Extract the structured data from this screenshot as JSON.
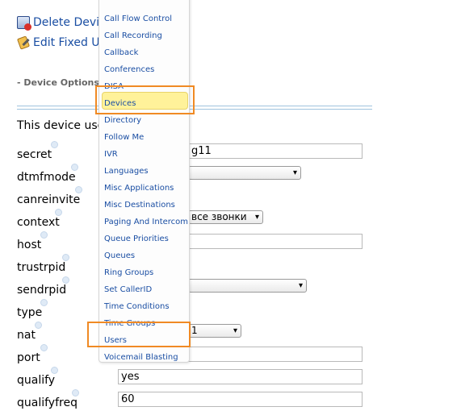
{
  "actions": {
    "delete_label": "Delete Devic",
    "edit_label": "Edit Fixed Us"
  },
  "section": {
    "heading": "- Device Options",
    "intro": "This device uses"
  },
  "fields": [
    {
      "name": "secret",
      "kind": "text",
      "value": "g11"
    },
    {
      "name": "dtmfmode",
      "kind": "select",
      "value": ""
    },
    {
      "name": "canreinvite",
      "kind": "none",
      "value": ""
    },
    {
      "name": "context",
      "kind": "select",
      "value": "все звонки"
    },
    {
      "name": "host",
      "kind": "text",
      "value": ""
    },
    {
      "name": "trustrpid",
      "kind": "none",
      "value": ""
    },
    {
      "name": "sendrpid",
      "kind": "select",
      "value": ""
    },
    {
      "name": "type",
      "kind": "none",
      "value": ""
    },
    {
      "name": "nat",
      "kind": "select",
      "value": "1"
    },
    {
      "name": "port",
      "kind": "text",
      "value": ""
    },
    {
      "name": "qualify",
      "kind": "text",
      "value": "yes"
    },
    {
      "name": "qualifyfreq",
      "kind": "text",
      "value": "60"
    }
  ],
  "menu": {
    "items": [
      "Call Flow Control",
      "Call Recording",
      "Callback",
      "Conferences",
      "DISA",
      "Devices",
      "Directory",
      "Follow Me",
      "IVR",
      "Languages",
      "Misc Applications",
      "Misc Destinations",
      "Paging And Intercom",
      "Queue Priorities",
      "Queues",
      "Ring Groups",
      "Set CallerID",
      "Time Conditions",
      "Time Groups",
      "Users",
      "Voicemail Blasting"
    ],
    "highlighted": "Devices",
    "callouts": [
      "Devices",
      "Users"
    ]
  },
  "colors": {
    "link": "#1a4ea3",
    "highlight": "#fff29a",
    "callout": "#f08a24",
    "rule": "#9fc3de"
  }
}
